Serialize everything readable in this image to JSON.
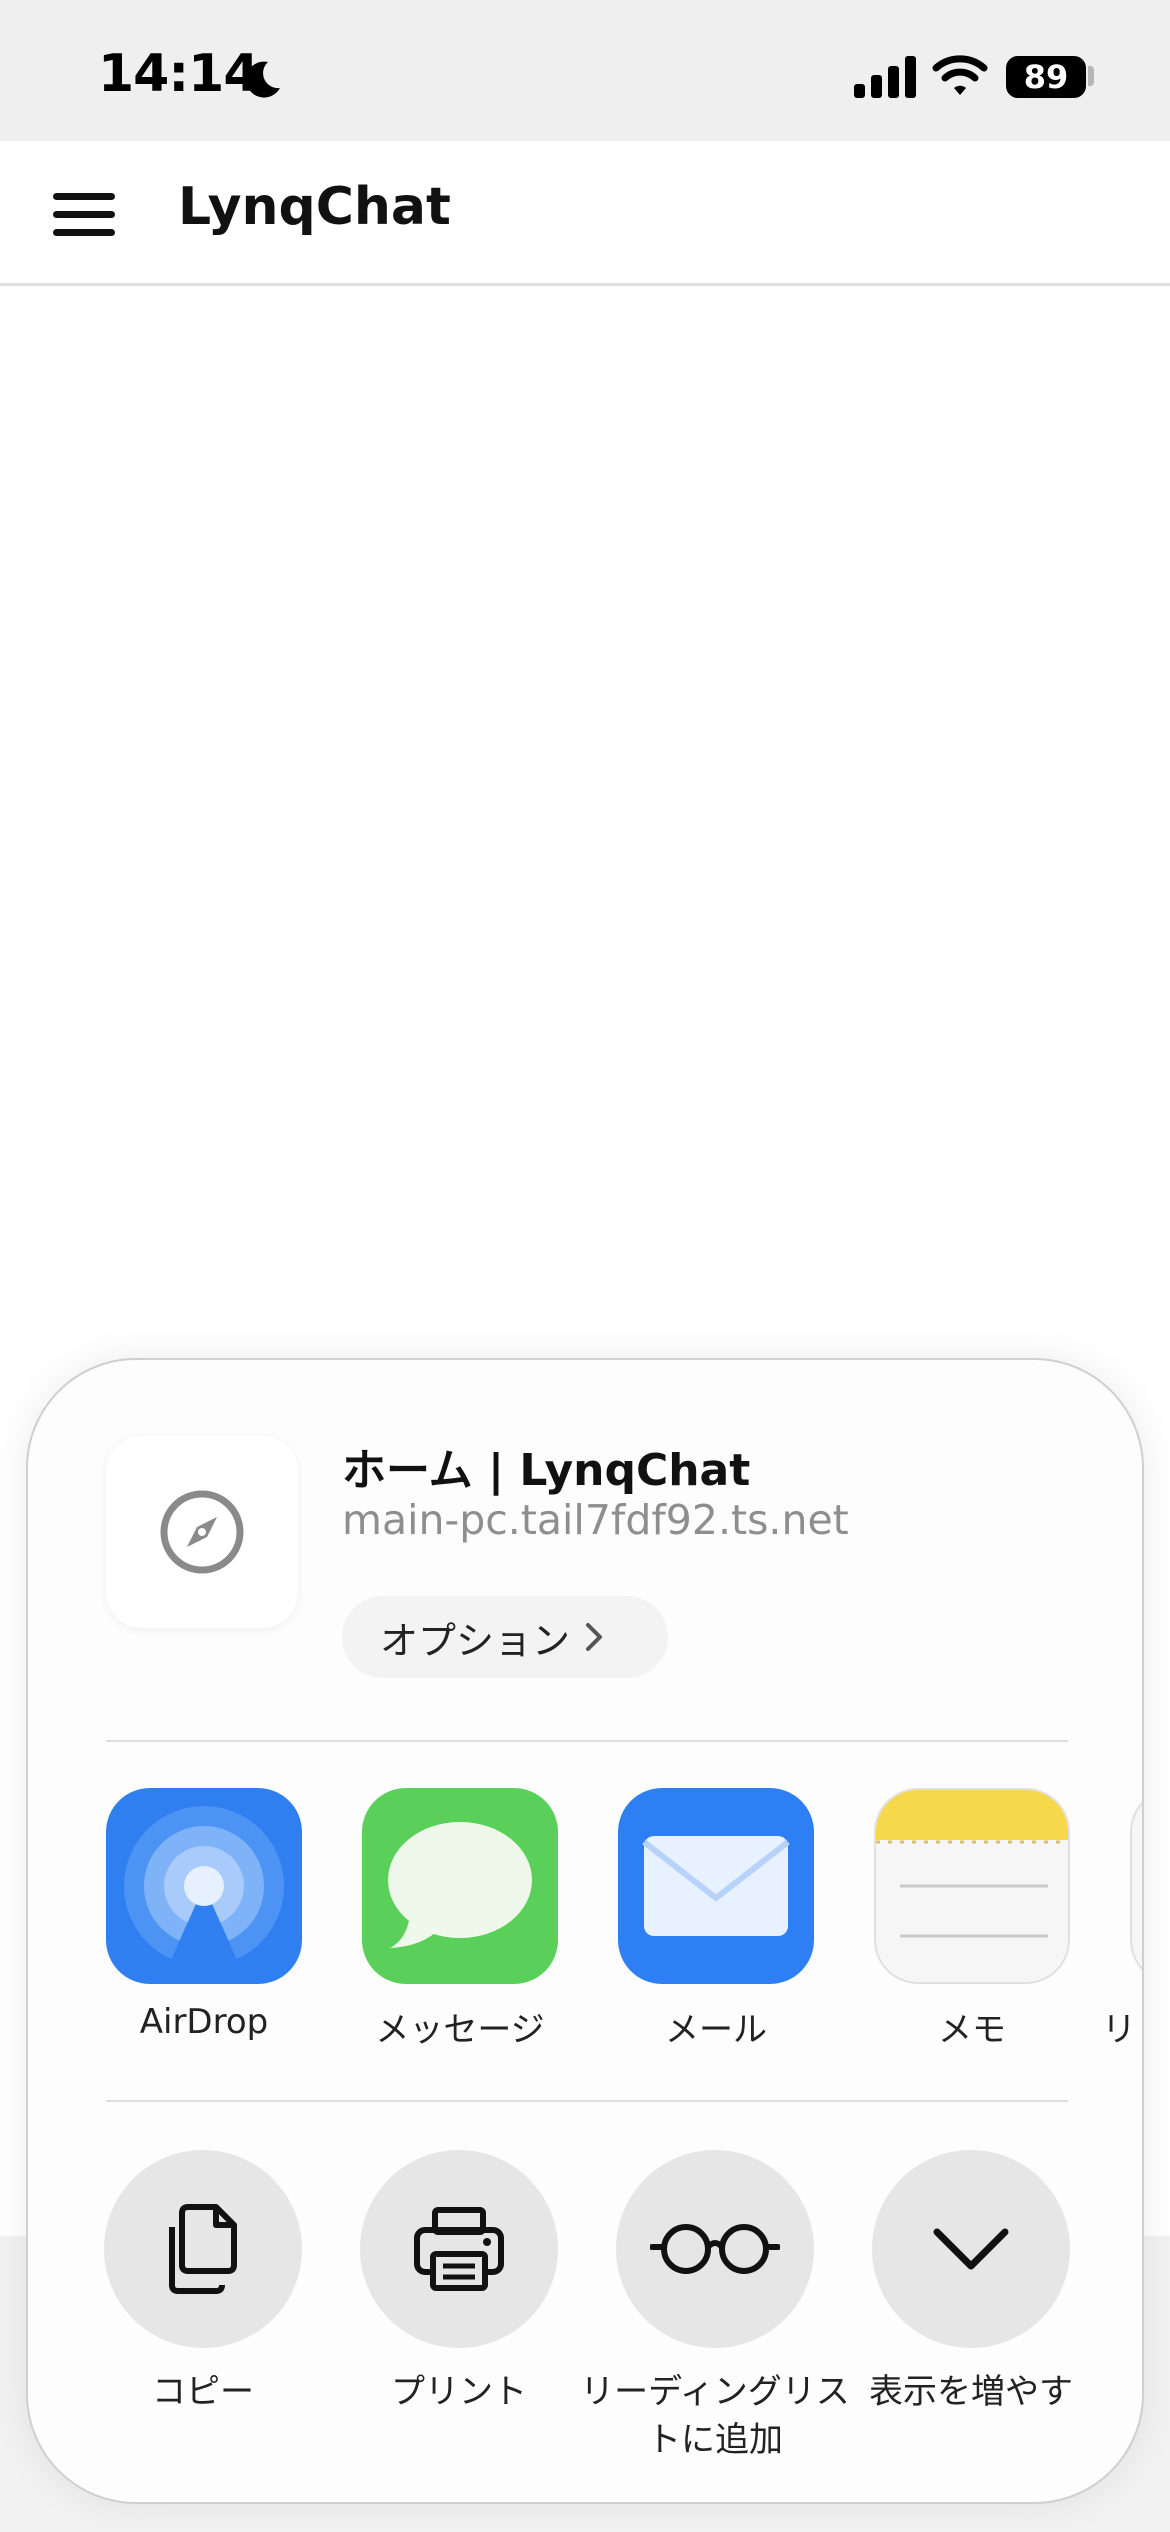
{
  "status_bar": {
    "time": "14:14",
    "battery": "89",
    "moon_icon": "moon-icon",
    "signal_icon": "cellular-signal-icon",
    "wifi_icon": "wifi-icon"
  },
  "header": {
    "menu_icon": "hamburger-menu-icon",
    "title": "LynqChat"
  },
  "share_sheet": {
    "page_title": "ホーム | LynqChat",
    "page_url": "main-pc.tail7fdf92.ts.net",
    "page_icon": "safari-compass-icon",
    "options_label": "オプション",
    "apps": [
      {
        "label": "AirDrop",
        "icon": "airdrop-icon"
      },
      {
        "label": "メッセージ",
        "icon": "messages-icon"
      },
      {
        "label": "メール",
        "icon": "mail-icon"
      },
      {
        "label": "メモ",
        "icon": "notes-icon"
      },
      {
        "label": "リ",
        "icon": "reminders-icon"
      }
    ],
    "actions": [
      {
        "label": "コピー",
        "icon": "copy-icon"
      },
      {
        "label": "プリント",
        "icon": "print-icon"
      },
      {
        "label": "リーディングリストに追加",
        "icon": "reading-list-icon"
      },
      {
        "label": "表示を増やす",
        "icon": "chevron-down-icon"
      }
    ]
  },
  "colors": {
    "airdrop_blue": "#2f7ff0",
    "messages_green": "#5ad05a",
    "mail_blue": "#2e7ff3",
    "notes_yellow": "#f7d84a",
    "action_circle": "#e6e6e6"
  }
}
